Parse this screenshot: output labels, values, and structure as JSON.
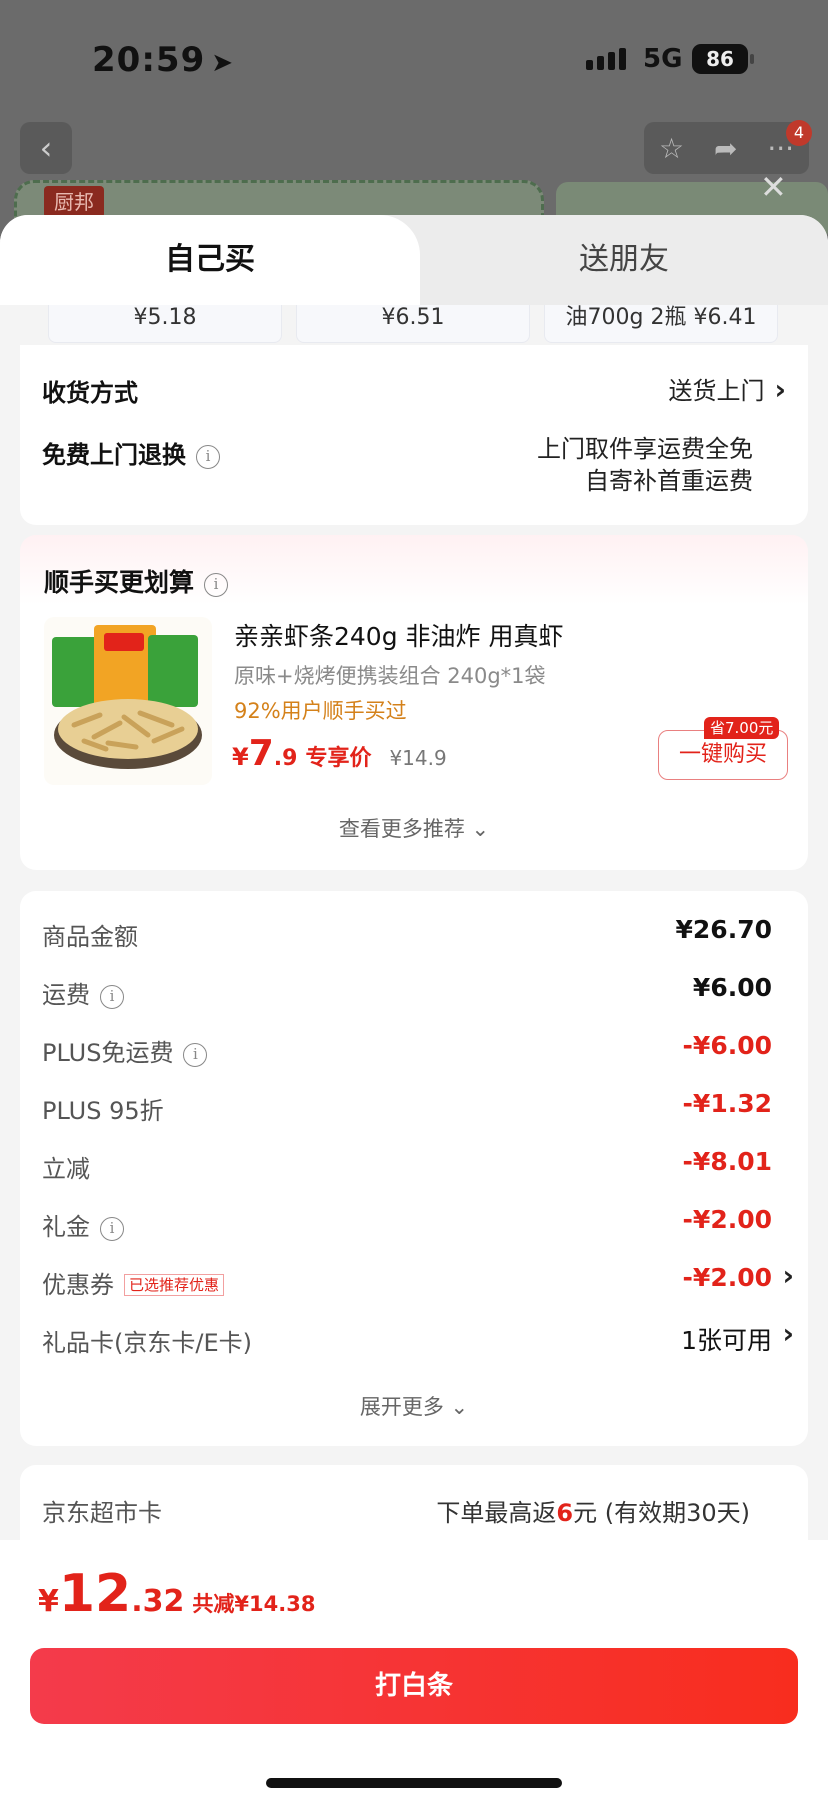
{
  "status": {
    "time": "20:59",
    "network": "5G",
    "battery": "86"
  },
  "background": {
    "badge_count": "4",
    "brand_tag": "厨邦"
  },
  "tabs": [
    {
      "label": "自己买"
    },
    {
      "label": "送朋友"
    }
  ],
  "price_strip": [
    "¥5.18",
    "¥6.51",
    "油700g 2瓶 ¥6.41"
  ],
  "delivery": {
    "label": "收货方式",
    "value": "送货上门",
    "return_label": "免费上门退换",
    "return_line1": "上门取件享运费全免",
    "return_line2": "自寄补首重运费"
  },
  "recommend": {
    "title": "顺手买更划算",
    "product_name": "亲亲虾条240g 非油炸 用真虾",
    "spec": "原味+烧烤便携装组合 240g*1袋",
    "popularity": "92%用户顺手买过",
    "currency": "¥",
    "price_int": "7",
    "price_dec": ".9",
    "exclusive": "专享价",
    "original_price": "¥14.9",
    "save_tag": "省7.00元",
    "buy_button": "一键购买",
    "more": "查看更多推荐"
  },
  "summary": {
    "rows": [
      {
        "label": "商品金额",
        "value": "¥26.70",
        "red": false,
        "info": false
      },
      {
        "label": "运费",
        "value": "¥6.00",
        "red": false,
        "info": true
      },
      {
        "label": "PLUS免运费",
        "value": "-¥6.00",
        "red": true,
        "info": true
      },
      {
        "label": "PLUS 95折",
        "value": "-¥1.32",
        "red": true,
        "info": false
      },
      {
        "label": "立减",
        "value": "-¥8.01",
        "red": true,
        "info": false
      },
      {
        "label": "礼金",
        "value": "-¥2.00",
        "red": true,
        "info": true
      },
      {
        "label": "优惠券",
        "value": "-¥2.00",
        "red": true,
        "info": false,
        "tag": "已选推荐优惠",
        "chevron": true
      },
      {
        "label": "礼品卡(京东卡/E卡)",
        "value": "1张可用",
        "red": false,
        "info": false,
        "chevron": true
      }
    ],
    "expand": "展开更多"
  },
  "jd_card": {
    "label": "京东超市卡",
    "value_prefix": "下单最高返",
    "value_amount": "6",
    "value_suffix": "元 (有效期30天)"
  },
  "footer": {
    "currency": "¥",
    "total_int": "12",
    "total_dec": ".32",
    "saving": "共减¥14.38",
    "pay_button": "打白条"
  },
  "colors": {
    "accent_red": "#e2231a",
    "orange": "#d4811a"
  }
}
